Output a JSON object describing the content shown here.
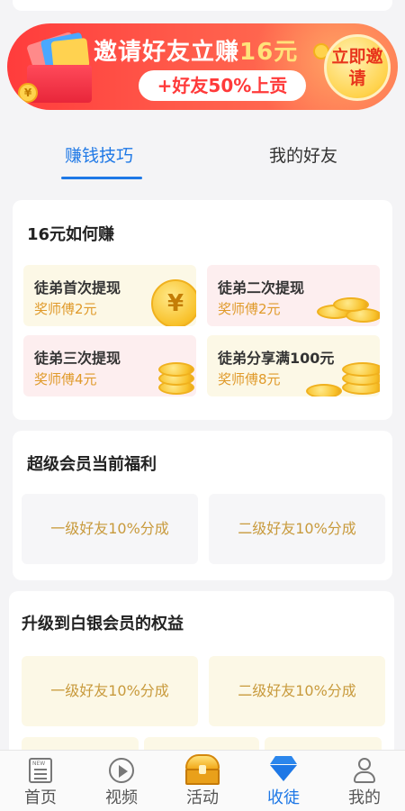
{
  "banner": {
    "title": "邀请好友立赚",
    "amount": "16元",
    "subtitle": "+好友50%上贡",
    "button_label": "立即邀请",
    "coin_glyph": "¥"
  },
  "tabs": {
    "items": [
      {
        "label": "赚钱技巧",
        "active": true
      },
      {
        "label": "我的好友",
        "active": false
      }
    ]
  },
  "earn_card": {
    "title": "16元如何赚",
    "tips": [
      {
        "title": "徒弟首次提现",
        "reward": "奖师傅2元"
      },
      {
        "title": "徒弟二次提现",
        "reward": "奖师傅2元"
      },
      {
        "title": "徒弟三次提现",
        "reward": "奖师傅4元"
      },
      {
        "title": "徒弟分享满100元",
        "reward": "奖师傅8元"
      }
    ],
    "coin_glyph": "¥"
  },
  "super_member_card": {
    "title": "超级会员当前福利",
    "benefits": [
      "一级好友10%分成",
      "二级好友10%分成"
    ]
  },
  "silver_card": {
    "title": "升级到白银会员的权益",
    "benefits": [
      "一级好友10%分成",
      "二级好友10%分成"
    ]
  },
  "bottom_nav": {
    "items": [
      {
        "label": "首页",
        "icon": "news-icon"
      },
      {
        "label": "视频",
        "icon": "play-icon"
      },
      {
        "label": "活动",
        "icon": "treasure-chest-icon"
      },
      {
        "label": "收徒",
        "icon": "diamond-icon",
        "active": true
      },
      {
        "label": "我的",
        "icon": "user-icon"
      }
    ],
    "news_badge": "NEW"
  },
  "colors": {
    "accent": "#1e78e6",
    "banner_start": "#ff3c3c",
    "banner_end": "#ff7a55",
    "reward_text": "#e09a2a",
    "benefit_text": "#c89a3c"
  }
}
